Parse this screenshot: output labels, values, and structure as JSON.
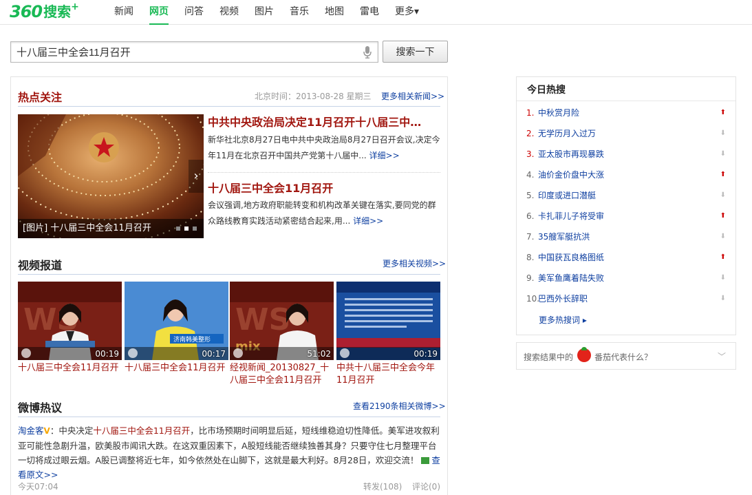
{
  "logo": {
    "num": "360",
    "text": "搜索",
    "plus": "+"
  },
  "nav": [
    "新闻",
    "网页",
    "问答",
    "视频",
    "图片",
    "音乐",
    "地图",
    "雷电",
    "更多▾"
  ],
  "search": {
    "value": "十八届三中全会11月召开",
    "button": "搜索一下"
  },
  "hot": {
    "title": "热点关注",
    "time": "北京时间：2013-08-28 星期三",
    "more": "更多相关新闻>>",
    "slide_caption": "[图片] 十八届三中全会11月召开",
    "news": [
      {
        "title": "中共中央政治局决定11月召开十八届三中…",
        "desc": "新华社北京8月27日电中共中央政治局8月27日召开会议,决定今年11月在北京召开中国共产党第十八届中...",
        "detail": "详细>>"
      },
      {
        "title": "十八届三中全会11月召开",
        "desc": "会议强调,地方政府职能转变和机构改革关键在落实,要同党的群众路线教育实践活动紧密结合起来,用...",
        "detail": "详细>>"
      }
    ]
  },
  "video": {
    "title": "视频报道",
    "more": "更多相关视频>>",
    "items": [
      {
        "caption": "十八届三中全会11月召开",
        "duration": "00:19"
      },
      {
        "caption": "十八届三中全会11月召开",
        "duration": "00:17",
        "overlay": "济南韩美整形"
      },
      {
        "caption": "经视新闻_20130827_十八届三中全会11月召开",
        "duration": "51:02"
      },
      {
        "caption": "中共十八届三中全会今年11月召开",
        "duration": "00:19"
      }
    ]
  },
  "weibo": {
    "title": "微博热议",
    "more": "查看2190条相关微博>>",
    "user": "淘金客",
    "pre": "：中央决定",
    "highlight": "十八届三中全会11月召开",
    "post": "，比市场预期时间明显后延，短线维稳迫切性降低。美军进攻叙利亚可能性急剧升温，欧美股市闻讯大跌。在这双重因素下，A股短线能否继续独善其身？只要守住七月整理平台一切将成过眼云烟。A股已调整将近七年，如今依然处在山脚下，这就是最大利好。8月28日，欢迎交流！",
    "orig": "查看原文>>",
    "time": "今天07:04",
    "repost": "转发(108)",
    "comment": "评论(0)"
  },
  "hot_search": {
    "title": "今日热搜",
    "items": [
      {
        "rank": "1.",
        "text": "中秋赏月险",
        "trend": "up"
      },
      {
        "rank": "2.",
        "text": "无学历月入过万",
        "trend": "down"
      },
      {
        "rank": "3.",
        "text": "亚太股市再现暴跌",
        "trend": "down"
      },
      {
        "rank": "4.",
        "text": "油价金价盘中大涨",
        "trend": "up"
      },
      {
        "rank": "5.",
        "text": "印度或进口潜艇",
        "trend": "down"
      },
      {
        "rank": "6.",
        "text": "卡扎菲儿子将受审",
        "trend": "up"
      },
      {
        "rank": "7.",
        "text": "35艘军艇抗洪",
        "trend": "down"
      },
      {
        "rank": "8.",
        "text": "中国获瓦良格图纸",
        "trend": "up"
      },
      {
        "rank": "9.",
        "text": "美军鱼鹰着陆失败",
        "trend": "down"
      },
      {
        "rank": "10.",
        "text": "巴西外长辞职",
        "trend": "down"
      }
    ],
    "more": "更多热搜词 ▸"
  },
  "tomato": {
    "text1": "搜索结果中的",
    "text2": "番茄代表什么？"
  },
  "colors": {
    "brand": "#19b955",
    "headline": "#a1160f",
    "link": "#0e3fa0"
  }
}
